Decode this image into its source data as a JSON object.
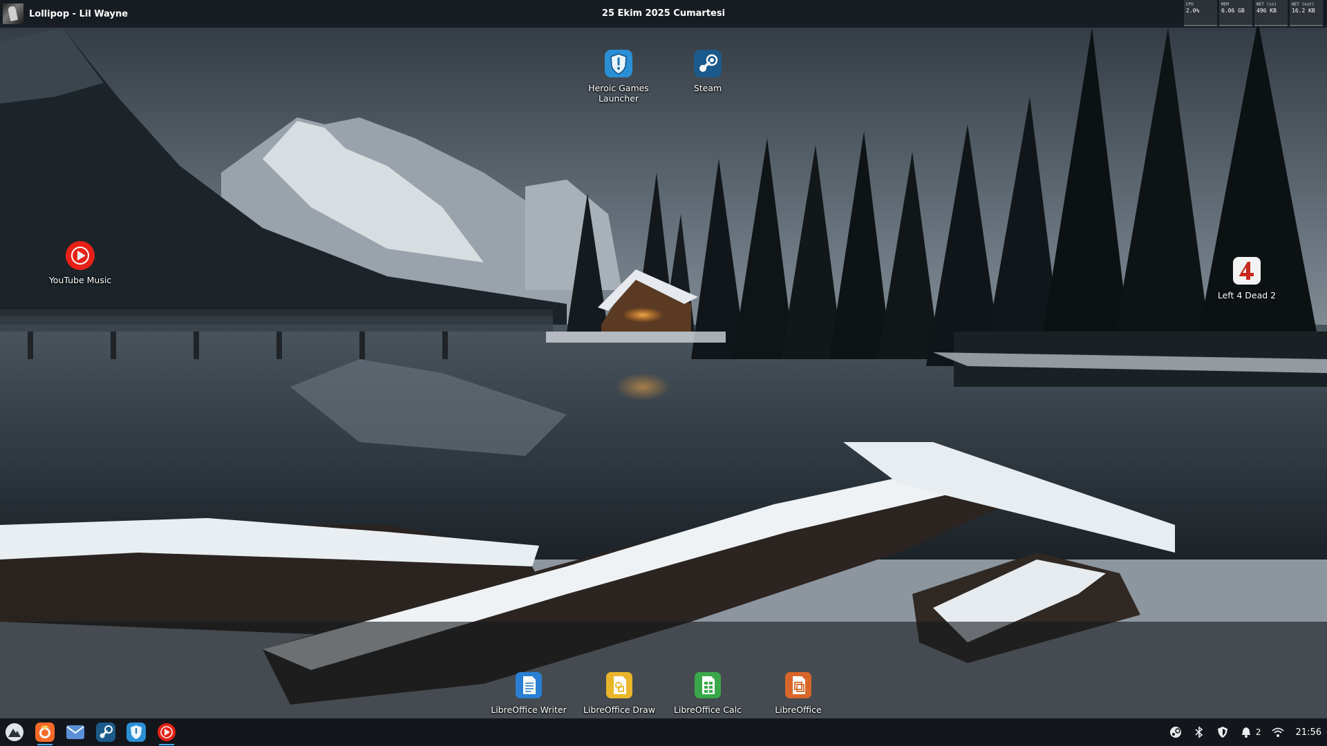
{
  "top_panel": {
    "media_title": "Lollipop - Lil Wayne",
    "date": "25 Ekim 2025 Cumartesi",
    "monitors": [
      {
        "label": "CPU",
        "value": "2.0%"
      },
      {
        "label": "MEM",
        "value": "6.06 GB"
      },
      {
        "label": "NET (in)",
        "value": "496 KB"
      },
      {
        "label": "NET (out)",
        "value": "16.2 KB"
      }
    ]
  },
  "desktop": {
    "icons": {
      "heroic": "Heroic Games Launcher",
      "steam": "Steam",
      "youtube_music": "YouTube Music",
      "left4dead2": "Left 4 Dead 2",
      "writer": "LibreOffice Writer",
      "draw": "LibreOffice Draw",
      "calc": "LibreOffice Calc",
      "libreoffice": "LibreOffice"
    }
  },
  "taskbar": {
    "apps": [
      "app-launcher-icon",
      "firefox-icon",
      "mail-icon",
      "steam-icon",
      "heroic-icon",
      "youtube-music-icon"
    ],
    "tray": {
      "notification_count": "2",
      "clock": "21:56"
    }
  },
  "colors": {
    "panel_bg": "#0f141a",
    "accent": "#3daee9",
    "youtube_red": "#e62117",
    "heroic_blue": "#2b8fd6",
    "steam_blue": "#1b5a8a",
    "writer_blue": "#2a7fd4",
    "draw_yellow": "#e9b52a",
    "calc_green": "#3aa84a",
    "impress_orange": "#d8662a"
  }
}
